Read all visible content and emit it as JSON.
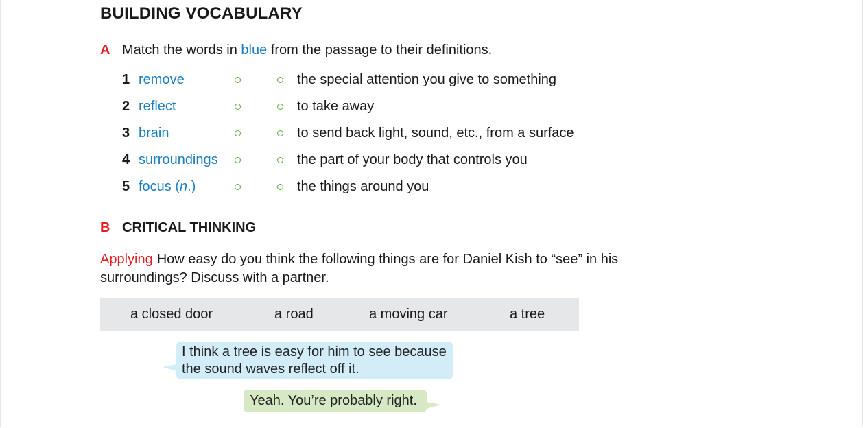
{
  "heading": "BUILDING VOCABULARY",
  "section_a": {
    "letter": "A",
    "instruction_before": "Match the words in ",
    "instruction_blue": "blue",
    "instruction_after": " from the passage to their definitions.",
    "items": [
      {
        "num": "1",
        "word": "remove",
        "definition": "the special attention you give to something"
      },
      {
        "num": "2",
        "word": "reflect",
        "definition": "to take away"
      },
      {
        "num": "3",
        "word": "brain",
        "definition": "to send back light, sound, etc., from a surface"
      },
      {
        "num": "4",
        "word": "surroundings",
        "definition": "the part of your body that controls you"
      },
      {
        "num": "5",
        "word": "focus (n.)",
        "definition": "the things around you"
      }
    ]
  },
  "section_b": {
    "letter": "B",
    "title": "CRITICAL THINKING",
    "label": "Applying",
    "question": "How easy do you think the following things are for Daniel Kish to “see” in his surroundings? Discuss with a partner.",
    "words": [
      "a closed door",
      "a road",
      "a moving car",
      "a tree"
    ],
    "dialogue": [
      {
        "speaker": "partner-1",
        "text_line1": "I think a tree is easy for him to see because",
        "text_line2": "the sound waves reflect off it."
      },
      {
        "speaker": "partner-2",
        "text": "Yeah. You’re probably right."
      }
    ]
  },
  "colors": {
    "accent_red": "#e31e24",
    "vocab_blue": "#1a7fc1",
    "match_dot_green": "#5aa83a",
    "word_box_gray": "#e6e7e8",
    "bubble_blue": "#d2ecf8",
    "bubble_green": "#d6e9c4"
  }
}
